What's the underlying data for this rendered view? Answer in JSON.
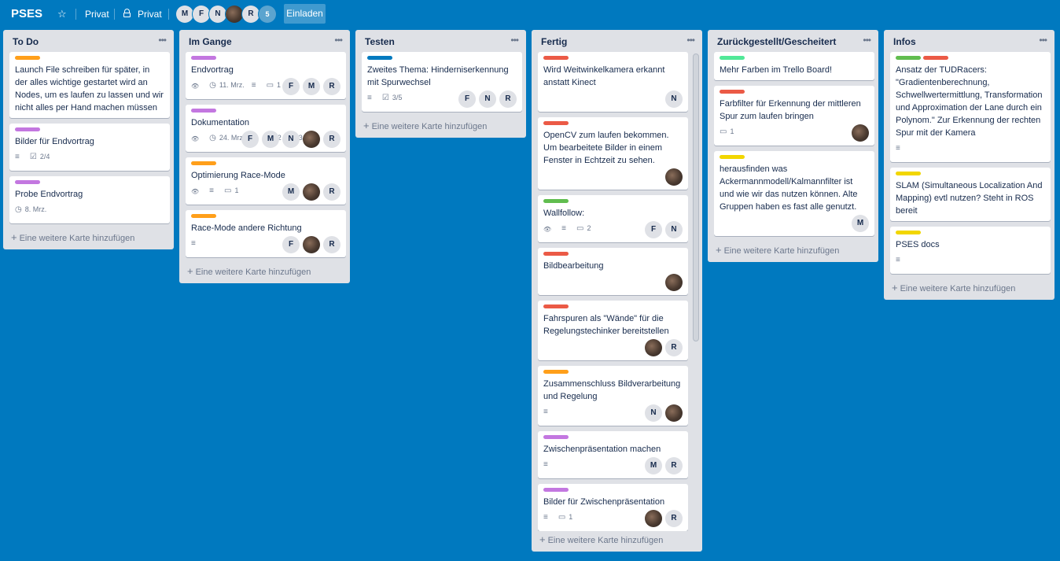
{
  "header": {
    "title": "PSES",
    "visibility_label_1": "Privat",
    "visibility_label_2": "Privat",
    "members": [
      "M",
      "F",
      "N",
      "",
      "R"
    ],
    "member_count": "5",
    "invite_label": "Einladen"
  },
  "add_card_label": "Eine weitere Karte hinzufügen",
  "colors": {
    "background": "#0079bf",
    "label_orange": "#ff9f1a",
    "label_purple": "#c377e0",
    "label_blue": "#0079bf",
    "label_red": "#eb5a46",
    "label_green": "#61bd4f",
    "label_lime": "#51e898",
    "label_yellow": "#f2d600"
  },
  "lists": [
    {
      "title": "To Do",
      "cards": [
        {
          "labels": [
            "orange"
          ],
          "title": "Launch File schreiben für später, in der alles wichtige gestartet wird an Nodes, um es laufen zu lassen und wir nicht alles per Hand machen müssen",
          "badges": [],
          "members": []
        },
        {
          "labels": [
            "purple"
          ],
          "title": "Bilder für Endvortrag",
          "badges": [
            {
              "icon": "description-icon",
              "text": ""
            },
            {
              "icon": "checklist-icon",
              "text": "2/4"
            }
          ],
          "members": []
        },
        {
          "labels": [
            "purple"
          ],
          "title": "Probe Endvortrag",
          "badges": [
            {
              "icon": "clock-icon",
              "text": "8. Mrz."
            }
          ],
          "members": []
        }
      ]
    },
    {
      "title": "Im Gange",
      "cards": [
        {
          "labels": [
            "purple"
          ],
          "title": "Endvortrag",
          "badges": [
            {
              "icon": "watch-icon",
              "text": ""
            },
            {
              "icon": "clock-icon",
              "text": "11. Mrz."
            },
            {
              "icon": "description-icon",
              "text": ""
            },
            {
              "icon": "comment-icon",
              "text": "1"
            }
          ],
          "members": [
            "F",
            "M",
            "R"
          ]
        },
        {
          "labels": [
            "purple"
          ],
          "title": "Dokumentation",
          "badges": [
            {
              "icon": "watch-icon",
              "text": ""
            },
            {
              "icon": "clock-icon",
              "text": "24. Mrz."
            },
            {
              "icon": "description-icon",
              "text": ""
            },
            {
              "icon": "comment-icon",
              "text": "2"
            },
            {
              "icon": "checklist-icon",
              "text": "3/6"
            }
          ],
          "members": [
            "F",
            "M",
            "N",
            "",
            "R"
          ]
        },
        {
          "labels": [
            "orange"
          ],
          "title": "Optimierung Race-Mode",
          "badges": [
            {
              "icon": "watch-icon",
              "text": ""
            },
            {
              "icon": "description-icon",
              "text": ""
            },
            {
              "icon": "comment-icon",
              "text": "1"
            }
          ],
          "members": [
            "M",
            "",
            "R"
          ]
        },
        {
          "labels": [
            "orange"
          ],
          "title": "Race-Mode andere Richtung",
          "badges": [
            {
              "icon": "description-icon",
              "text": ""
            }
          ],
          "members": [
            "F",
            "",
            "R"
          ]
        }
      ]
    },
    {
      "title": "Testen",
      "cards": [
        {
          "labels": [
            "blue"
          ],
          "title": "Zweites Thema: Hinderniserkennung mit Spurwechsel",
          "badges": [
            {
              "icon": "description-icon",
              "text": ""
            },
            {
              "icon": "checklist-icon",
              "text": "3/5"
            }
          ],
          "members": [
            "F",
            "N",
            "R"
          ]
        }
      ]
    },
    {
      "title": "Fertig",
      "cards": [
        {
          "labels": [
            "red"
          ],
          "title": "Wird Weitwinkelkamera erkannt anstatt Kinect",
          "badges": [],
          "members": [
            "N"
          ]
        },
        {
          "labels": [
            "red"
          ],
          "title": "OpenCV zum laufen bekommen. Um bearbeitete Bilder in einem Fenster in Echtzeit zu sehen.",
          "badges": [],
          "members": [
            ""
          ]
        },
        {
          "labels": [
            "green"
          ],
          "title": "Wallfollow:",
          "badges": [
            {
              "icon": "watch-icon",
              "text": ""
            },
            {
              "icon": "description-icon",
              "text": ""
            },
            {
              "icon": "comment-icon",
              "text": "2"
            }
          ],
          "members": [
            "F",
            "N"
          ]
        },
        {
          "labels": [
            "red"
          ],
          "title": "Bildbearbeitung",
          "badges": [],
          "members": [
            ""
          ]
        },
        {
          "labels": [
            "red"
          ],
          "title": "Fahrspuren als \"Wände\" für die Regelungstechinker bereitstellen",
          "badges": [],
          "members": [
            "",
            "R"
          ]
        },
        {
          "labels": [
            "orange"
          ],
          "title": "Zusammenschluss Bildverarbeitung und Regelung",
          "badges": [
            {
              "icon": "description-icon",
              "text": ""
            }
          ],
          "members": [
            "N",
            ""
          ]
        },
        {
          "labels": [
            "purple"
          ],
          "title": "Zwischenpräsentation machen",
          "badges": [
            {
              "icon": "description-icon",
              "text": ""
            }
          ],
          "members": [
            "M",
            "R"
          ]
        },
        {
          "labels": [
            "purple"
          ],
          "title": "Bilder für Zwischenpräsentation",
          "badges": [
            {
              "icon": "description-icon",
              "text": ""
            },
            {
              "icon": "comment-icon",
              "text": "1"
            }
          ],
          "members": [
            "",
            "R"
          ]
        }
      ]
    },
    {
      "title": "Zurückgestellt/Gescheitert",
      "cards": [
        {
          "labels": [
            "lime"
          ],
          "title": "Mehr Farben im Trello Board!",
          "badges": [],
          "members": []
        },
        {
          "labels": [
            "red"
          ],
          "title": "Farbfilter für Erkennung der mittleren Spur zum laufen bringen",
          "badges": [
            {
              "icon": "comment-icon",
              "text": "1"
            }
          ],
          "members": [
            ""
          ]
        },
        {
          "labels": [
            "yellow"
          ],
          "title": "herausfinden was Ackermannmodell/Kalmannfilter ist und wie wir das nutzen können. Alte Gruppen haben es fast alle genutzt.",
          "badges": [],
          "members": [
            "M"
          ]
        }
      ]
    },
    {
      "title": "Infos",
      "cards": [
        {
          "labels": [
            "green",
            "red"
          ],
          "title": "Ansatz der TUDRacers: \"Gradientenberechnung, Schwellwertermittlung, Transformation und Approximation der Lane durch ein Polynom.\" Zur Erkennung der rechten Spur mit der Kamera",
          "badges": [
            {
              "icon": "description-icon",
              "text": ""
            }
          ],
          "members": []
        },
        {
          "labels": [
            "yellow"
          ],
          "title": "SLAM (Simultaneous Localization And Mapping) evtl nutzen? Steht in ROS bereit",
          "badges": [],
          "members": []
        },
        {
          "labels": [
            "yellow"
          ],
          "title": "PSES docs",
          "badges": [
            {
              "icon": "description-icon",
              "text": ""
            }
          ],
          "members": []
        }
      ]
    }
  ]
}
